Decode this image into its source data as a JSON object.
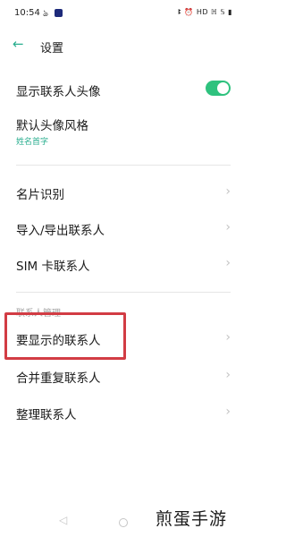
{
  "status_bar": {
    "time": "10:54",
    "left_icons": [
      "notification-icon",
      "app-icon"
    ],
    "right_text": "ꔪ ⏰ HD ℍ 𝕊 ▮"
  },
  "header": {
    "title": "设置",
    "back_icon": "back-arrow-icon"
  },
  "settings": {
    "show_avatar": {
      "label": "显示联系人头像",
      "toggle_on": true
    },
    "avatar_style": {
      "label": "默认头像风格",
      "value": "姓名首字"
    },
    "card_recognition": {
      "label": "名片识别"
    },
    "import_export": {
      "label": "导入/导出联系人"
    },
    "sim_contacts": {
      "label": "SIM 卡联系人"
    }
  },
  "contact_management": {
    "section_label": "联系人管理",
    "items": [
      {
        "label": "要显示的联系人"
      },
      {
        "label": "合并重复联系人"
      },
      {
        "label": "整理联系人"
      }
    ]
  },
  "navbar": {
    "back_icon": "nav-back-icon",
    "home_icon": "nav-home-icon"
  },
  "watermark": "煎蛋手游",
  "colors": {
    "accent": "#2aae8f",
    "toggle_on": "#2ec27e",
    "highlight_border": "#d23c44"
  }
}
